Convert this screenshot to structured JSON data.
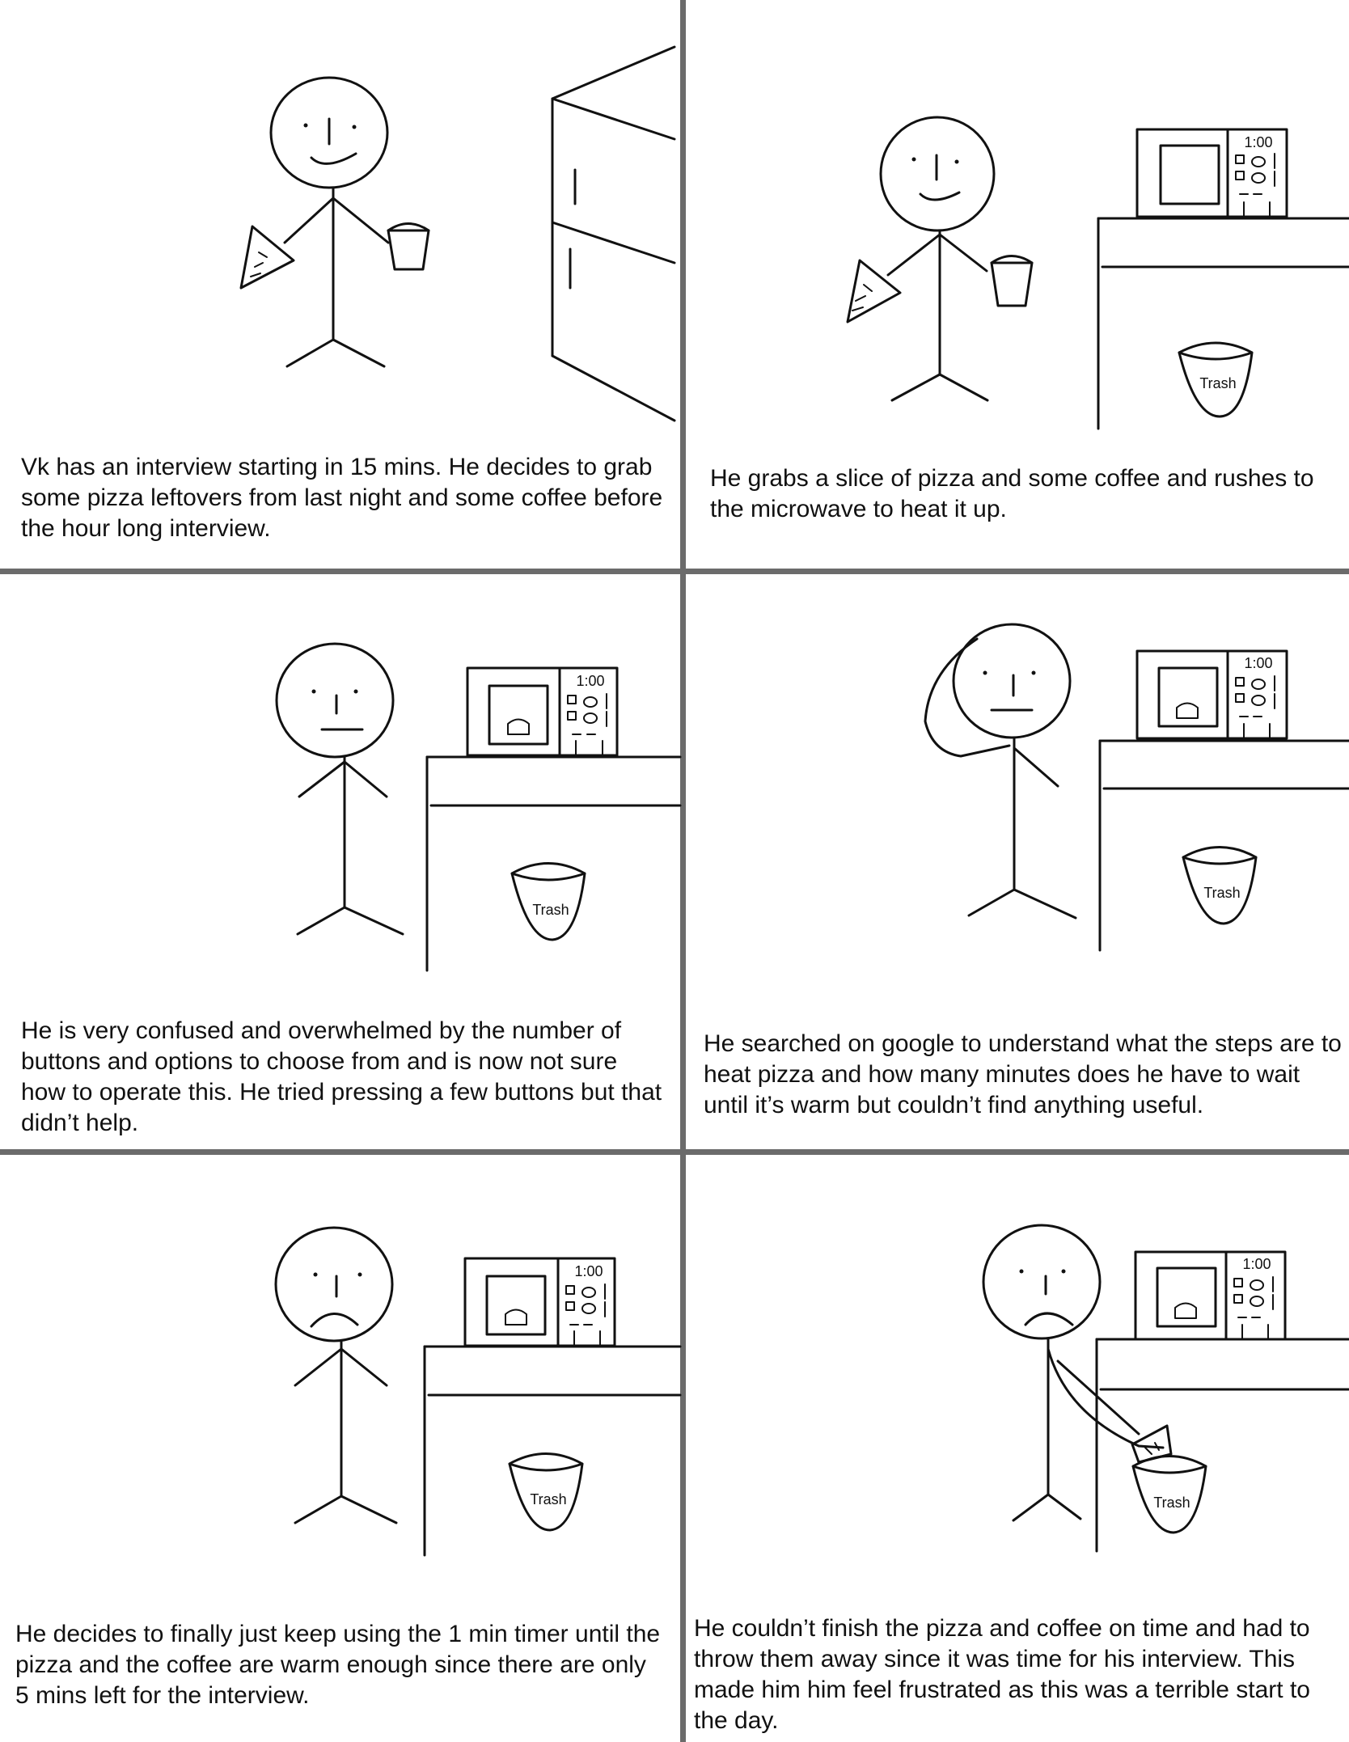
{
  "colors": {
    "ink": "#111111",
    "divider": "#6b6b6b",
    "background": "#ffffff"
  },
  "panels": [
    {
      "caption": "Vk has an interview starting in 15 mins. He decides to grab some pizza leftovers from last night and some coffee before the hour long interview."
    },
    {
      "caption": "He grabs a slice of pizza and some coffee and rushes to the microwave to heat it up.",
      "microwave_display": "1:00",
      "trash_label": "Trash"
    },
    {
      "caption": "He is very confused and overwhelmed by the number of buttons and options to choose from and is now not sure how to operate this. He tried pressing a few buttons but that didn’t help.",
      "microwave_display": "1:00",
      "trash_label": "Trash"
    },
    {
      "caption": "He searched on google to understand what the steps are to heat pizza and how many minutes does he have to wait until it’s warm but couldn’t find anything useful.",
      "microwave_display": "1:00",
      "trash_label": "Trash"
    },
    {
      "caption": "He decides to finally just keep using the 1 min timer until the pizza and the coffee are warm enough since there are only 5 mins left for the interview.",
      "microwave_display": "1:00",
      "trash_label": "Trash"
    },
    {
      "caption": "He couldn’t finish the pizza and coffee on time and had to throw them away since it was time for his interview. This made him him feel frustrated as this was a terrible start to the day.",
      "microwave_display": "1:00",
      "trash_label": "Trash"
    }
  ]
}
